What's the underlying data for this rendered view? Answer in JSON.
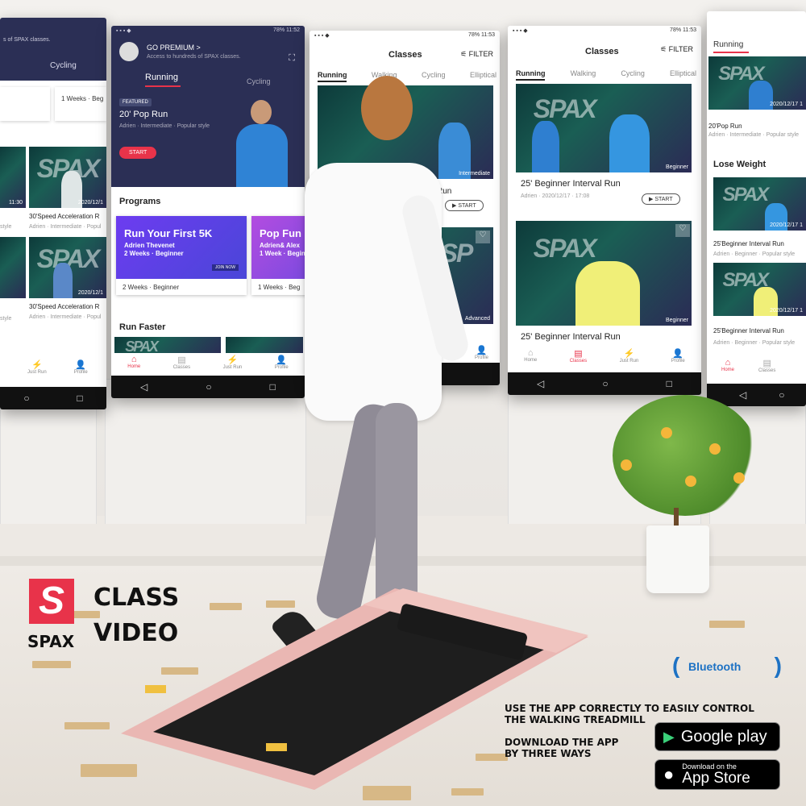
{
  "brand": {
    "logo_letter": "S",
    "name": "SPAX",
    "accent": "#e8334a"
  },
  "headline": {
    "line1": "CLASS",
    "line2": "VIDEO"
  },
  "bluetooth": "Bluetooth",
  "promo": {
    "line1": "USE THE APP CORRECTLY TO EASILY CONTROL",
    "line2": "THE WALKING TREADMILL",
    "line3": "DOWNLOAD THE APP",
    "line4": "BY THREE WAYS"
  },
  "stores": {
    "google": "Google play",
    "apple_small": "Download on the",
    "apple": "App Store"
  },
  "phone1": {
    "header_text": "s of SPAX classes.",
    "tab": "Cycling",
    "card_top": "1 Weeks · Beg",
    "items": [
      {
        "title": "30'Speed Acceleration R",
        "meta": "Adrien · Intermediate · Popul",
        "date": "2020/12/1"
      },
      {
        "title": "30'Speed Acceleration R",
        "meta": "Adrien · Intermediate · Popul",
        "date": "2020/12/1"
      }
    ],
    "side_text": [
      "style",
      "style"
    ],
    "time": "11:30",
    "nav": [
      "Just Run",
      "Profile"
    ]
  },
  "phone2": {
    "status_right": "78% 11:52",
    "premium_title": "GO PREMIUM >",
    "premium_sub": "Access to hundreds of SPAX classes.",
    "tabs": [
      "Running",
      "Cycling"
    ],
    "featured_badge": "FEATURED",
    "featured_title": "20' Pop Run",
    "featured_meta": "Adrien · Intermediate · Popular style",
    "start": "START",
    "programs_heading": "Programs",
    "programs": [
      {
        "title": "Run Your First 5K",
        "coach": "Adrien Thevenet",
        "detail": "2 Weeks · Beginner",
        "join": "JOIN NOW",
        "caption": "2 Weeks · Beginner"
      },
      {
        "title": "Pop Fun",
        "coach": "Adrien& Alex",
        "detail": "1 Week · Beginner",
        "caption": "1 Weeks · Beg"
      }
    ],
    "run_faster": "Run Faster",
    "nav": [
      "Home",
      "Classes",
      "Just Run",
      "Profile"
    ]
  },
  "phone3": {
    "status_right": "78% 11:53",
    "title": "Classes",
    "filter": "FILTER",
    "tabs": [
      "Running",
      "Walking",
      "Cycling",
      "Elliptical"
    ],
    "tag1": "Intermediate",
    "run_label": "Run",
    "start": "START",
    "tag2": "Advanced",
    "nav": [
      "Profile"
    ]
  },
  "phone4": {
    "status_right": "78% 11:53",
    "title": "Classes",
    "filter": "FILTER",
    "tabs": [
      "Running",
      "Walking",
      "Cycling",
      "Elliptical"
    ],
    "card1": {
      "title": "25' Beginner Interval Run",
      "meta": "Adrien · 2020/12/17 · 17:08",
      "tag": "Beginner",
      "start": "START"
    },
    "card2": {
      "title": "25' Beginner Interval Run",
      "tag": "Beginner"
    },
    "nav": [
      "Home",
      "Classes",
      "Just Run",
      "Profile"
    ]
  },
  "phone5": {
    "tab": "Running",
    "top_title": "20'Pop Run",
    "top_meta": "Adrien · Intermediate · Popular style",
    "section": "Lose Weight",
    "items": [
      {
        "title": "25'Beginner Interval Run",
        "meta": "Adrien · Beginner · Popular style",
        "date": "2020/12/17 1"
      },
      {
        "title": "25'Beginner Interval Run",
        "meta": "Adrien · Beginner · Popular style",
        "date": "2020/12/17 1"
      }
    ],
    "date_top": "2020/12/17 1",
    "nav": [
      "Home",
      "Classes"
    ]
  }
}
